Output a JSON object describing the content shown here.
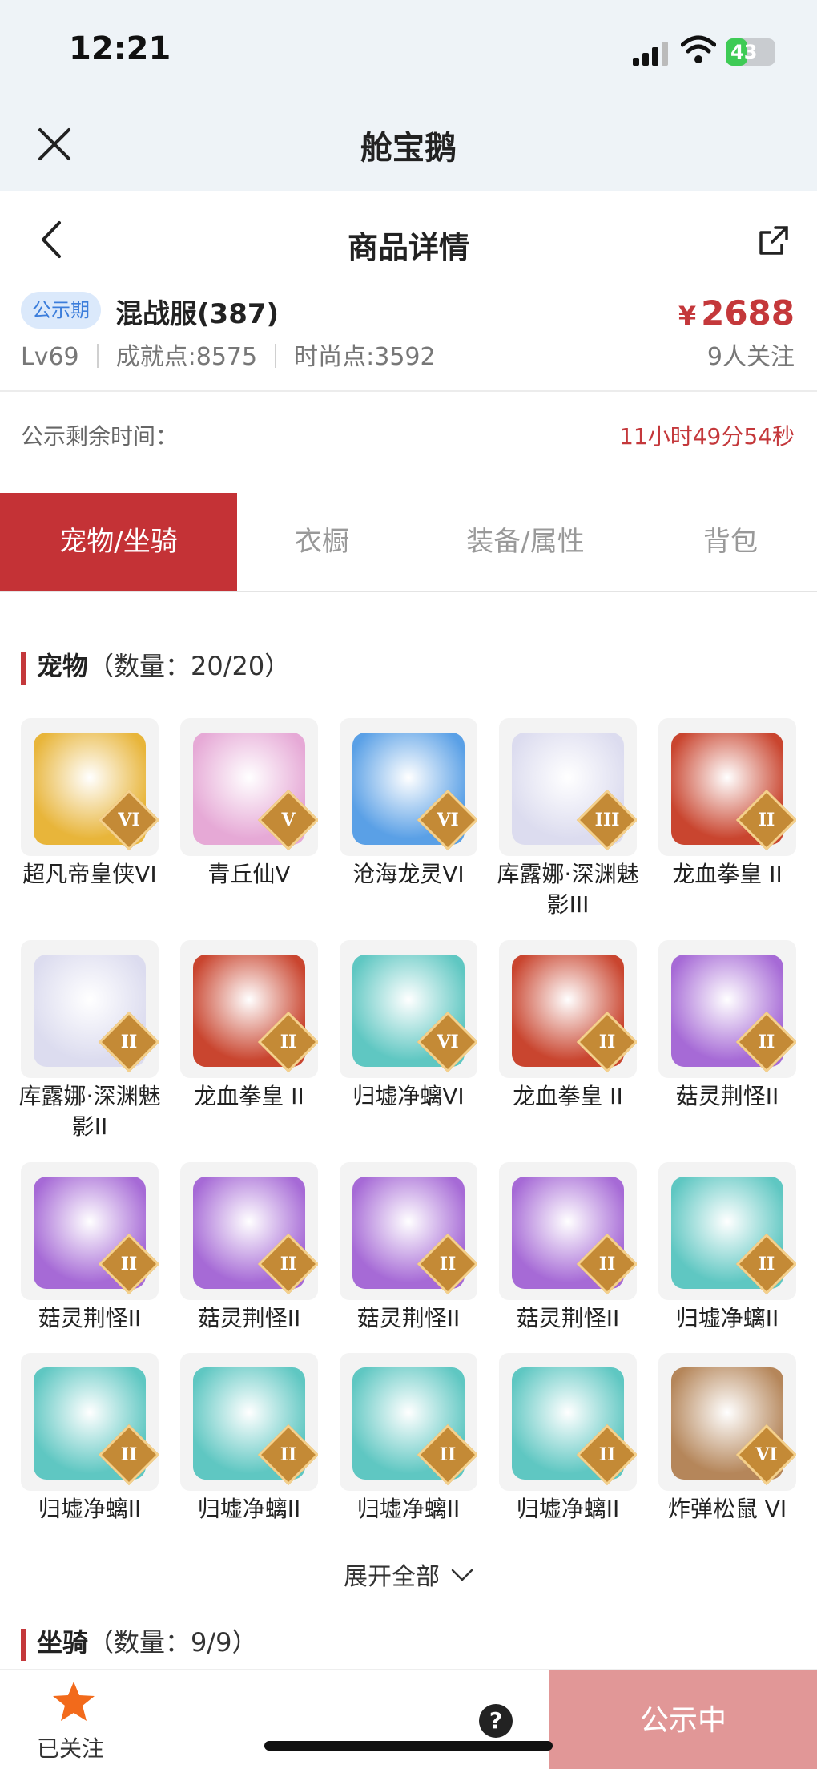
{
  "status_bar": {
    "time": "12:21",
    "battery": "43"
  },
  "app": {
    "title": "舱宝鹅"
  },
  "nav": {
    "title": "商品详情"
  },
  "product": {
    "badge": "公示期",
    "server": "混战服(387)",
    "price_symbol": "¥",
    "price": "2688",
    "level": "Lv69",
    "achievement": "成就点:8575",
    "fashion": "时尚点:3592",
    "followers": "9人关注"
  },
  "publicity": {
    "label": "公示剩余时间：",
    "remaining": "11小时49分54秒"
  },
  "tabs": [
    {
      "label": "宠物/坐骑",
      "active": true
    },
    {
      "label": "衣橱",
      "active": false
    },
    {
      "label": "装备/属性",
      "active": false
    },
    {
      "label": "背包",
      "active": false
    }
  ],
  "pets_section": {
    "title": "宠物",
    "count": "（数量：20/20）"
  },
  "pets": [
    {
      "name": "超凡帝皇侠VI",
      "tier": "VI",
      "color": "#e8b53a"
    },
    {
      "name": "青丘仙V",
      "tier": "V",
      "color": "#e6a9d6"
    },
    {
      "name": "沧海龙灵VI",
      "tier": "VI",
      "color": "#5aa0e6"
    },
    {
      "name": "库露娜·深渊魅影III",
      "tier": "III",
      "color": "#dcdcef"
    },
    {
      "name": "龙血拳皇 II",
      "tier": "II",
      "color": "#c9452f"
    },
    {
      "name": "库露娜·深渊魅影II",
      "tier": "II",
      "color": "#dcdcef"
    },
    {
      "name": "龙血拳皇 II",
      "tier": "II",
      "color": "#c9452f"
    },
    {
      "name": "归墟净螭VI",
      "tier": "VI",
      "color": "#5fc7c2"
    },
    {
      "name": "龙血拳皇 II",
      "tier": "II",
      "color": "#c9452f"
    },
    {
      "name": "菇灵荆怪II",
      "tier": "II",
      "color": "#a66ad6"
    },
    {
      "name": "菇灵荆怪II",
      "tier": "II",
      "color": "#a66ad6"
    },
    {
      "name": "菇灵荆怪II",
      "tier": "II",
      "color": "#a66ad6"
    },
    {
      "name": "菇灵荆怪II",
      "tier": "II",
      "color": "#a66ad6"
    },
    {
      "name": "菇灵荆怪II",
      "tier": "II",
      "color": "#a66ad6"
    },
    {
      "name": "归墟净螭II",
      "tier": "II",
      "color": "#5fc7c2"
    },
    {
      "name": "归墟净螭II",
      "tier": "II",
      "color": "#5fc7c2"
    },
    {
      "name": "归墟净螭II",
      "tier": "II",
      "color": "#5fc7c2"
    },
    {
      "name": "归墟净螭II",
      "tier": "II",
      "color": "#5fc7c2"
    },
    {
      "name": "归墟净螭II",
      "tier": "II",
      "color": "#5fc7c2"
    },
    {
      "name": "炸弹松鼠 VI",
      "tier": "VI",
      "color": "#b5865a"
    }
  ],
  "expand": {
    "label": "展开全部"
  },
  "mounts_section": {
    "title": "坐骑",
    "count": "（数量：9/9）"
  },
  "bottom": {
    "follow_label": "已关注",
    "status_button": "公示中"
  },
  "colors": {
    "accent": "#c4383b",
    "tab_active": "#c43236",
    "status_button": "#e19797",
    "badge_bg": "#dbe9fb",
    "star": "#f26a1b"
  }
}
